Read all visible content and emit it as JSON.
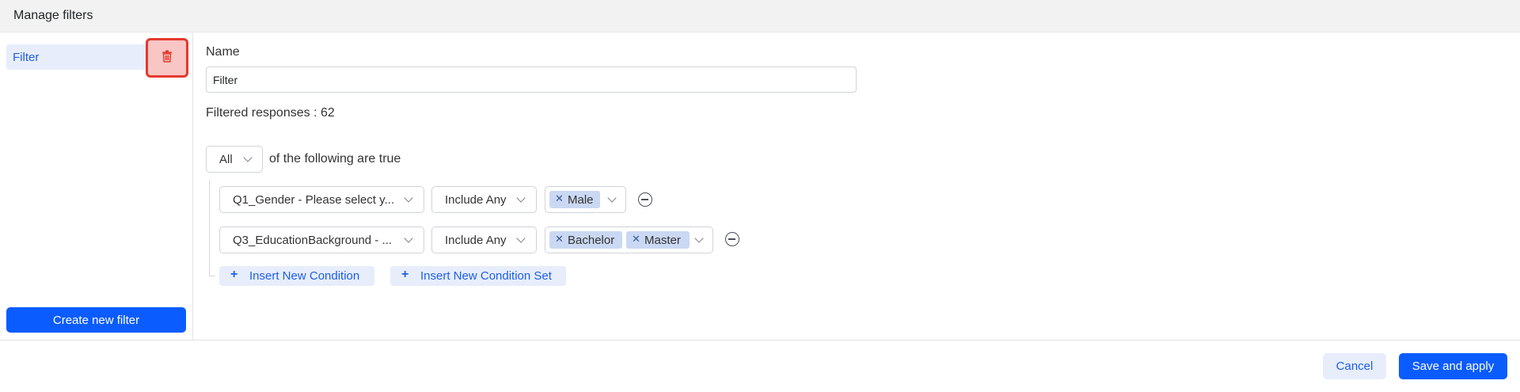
{
  "dialog": {
    "title": "Manage filters"
  },
  "sidebar": {
    "filters": [
      {
        "label": "Filter"
      }
    ],
    "create_button": "Create new filter",
    "delete_icon": "trash-icon"
  },
  "form": {
    "name_label": "Name",
    "name_value": "Filter",
    "filtered_responses": "Filtered responses : 62",
    "match_mode": "All",
    "match_text": "of the following are true"
  },
  "conditions": [
    {
      "field": "Q1_Gender - Please select y...",
      "operator": "Include Any",
      "values": [
        "Male"
      ]
    },
    {
      "field": "Q3_EducationBackground - ...",
      "operator": "Include Any",
      "values": [
        "Bachelor",
        "Master"
      ]
    }
  ],
  "actions": {
    "insert_condition": "Insert New Condition",
    "insert_condition_set": "Insert New Condition Set"
  },
  "footer": {
    "cancel": "Cancel",
    "save": "Save and apply"
  },
  "colors": {
    "accent": "#0a5cff",
    "accent_light": "#e7edfb",
    "delete_highlight": "#e3392e",
    "tag_bg": "#cad8f3"
  }
}
